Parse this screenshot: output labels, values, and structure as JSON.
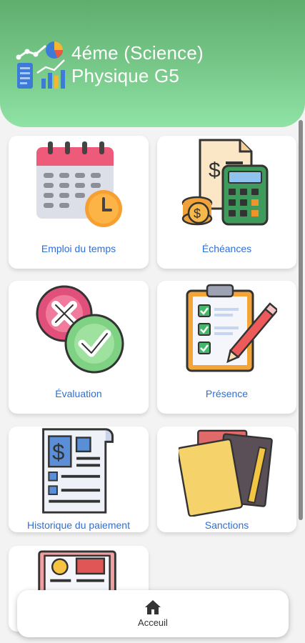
{
  "header": {
    "title_line1": "4éme (Science)",
    "title_line2": "Physique G5",
    "icon": "analytics-report-icon"
  },
  "menu": {
    "schedule": {
      "label": "Emploi du temps",
      "icon": "calendar-clock-icon"
    },
    "deadlines": {
      "label": "Échéances",
      "icon": "invoice-calculator-icon"
    },
    "evaluation": {
      "label": "Évaluation",
      "icon": "cross-check-icon"
    },
    "attendance": {
      "label": "Présence",
      "icon": "clipboard-checklist-icon"
    },
    "payment_history": {
      "label": "Historique du paiement",
      "icon": "payment-document-icon"
    },
    "sanctions": {
      "label": "Sanctions",
      "icon": "notebooks-icon"
    },
    "news": {
      "label": "",
      "icon": "newspaper-icon"
    }
  },
  "bottom_nav": {
    "home_label": "Acceuil",
    "home_icon": "home-icon"
  },
  "colors": {
    "header_green": "#6cbd7d",
    "label_blue": "#2d6fd8"
  }
}
